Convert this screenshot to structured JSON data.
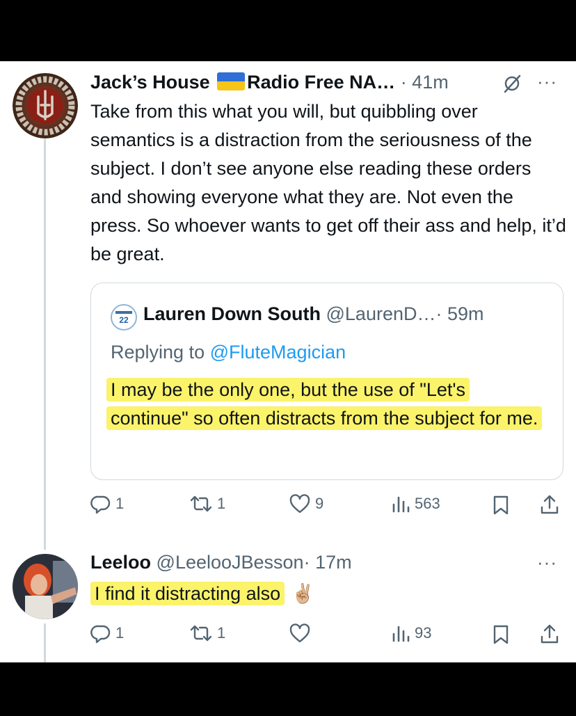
{
  "tweet1": {
    "author_name": "Jack’s House",
    "author_extra": "Radio Free NA…",
    "time": "· 41m",
    "text": "Take from this what you will, but quibbling over semantics is a distraction from the seriousness of the subject. I don’t see anyone else reading these orders and showing everyone what they are. Not even the press. So whoever wants to get off their ass and help, it’d be great.",
    "quote": {
      "author_name": "Lauren Down South",
      "handle": "@LaurenD…",
      "time": "· 59m",
      "replying_prefix": "Replying to",
      "replying_to": "@FluteMagician",
      "text": "I may be the only one, but the use of \"Let's continue\" so often distracts from the subject for me."
    },
    "actions": {
      "replies": "1",
      "reposts": "1",
      "likes": "9",
      "views": "563"
    }
  },
  "tweet2": {
    "author_name": "Leeloo",
    "handle": "@LeelooJBesson",
    "time": "· 17m",
    "text": "I find it distracting also",
    "emoji": "✌🏼",
    "actions": {
      "replies": "1",
      "reposts": "1",
      "likes": "",
      "views": "93"
    }
  },
  "more_icon": "···",
  "colors": {
    "highlight": "#fbf36a",
    "link": "#1d9bf0",
    "muted": "#536471",
    "thread_line": "#cfd9de"
  }
}
